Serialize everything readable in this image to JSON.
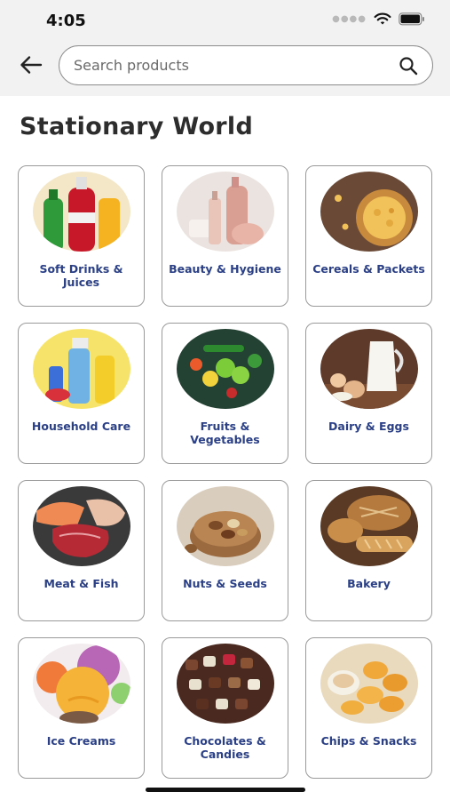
{
  "status_bar": {
    "time": "4:05",
    "icons": [
      "signal-dots-icon",
      "wifi-icon",
      "battery-icon"
    ]
  },
  "header": {
    "back_icon": "arrow-left-icon",
    "search": {
      "placeholder": "Search products",
      "value": "",
      "icon": "search-icon"
    }
  },
  "page": {
    "title": "Stationary World"
  },
  "categories": [
    {
      "label": "Soft Drinks & Juices",
      "icon": "soft-drinks-image"
    },
    {
      "label": "Beauty & Hygiene",
      "icon": "beauty-image"
    },
    {
      "label": "Cereals & Packets",
      "icon": "cereals-image"
    },
    {
      "label": "Household Care",
      "icon": "household-image"
    },
    {
      "label": "Fruits & Vegetables",
      "icon": "fruits-image"
    },
    {
      "label": "Dairy & Eggs",
      "icon": "dairy-image"
    },
    {
      "label": "Meat & Fish",
      "icon": "meat-image"
    },
    {
      "label": "Nuts & Seeds",
      "icon": "nuts-image"
    },
    {
      "label": "Bakery",
      "icon": "bakery-image"
    },
    {
      "label": "Ice Creams",
      "icon": "ice-cream-image"
    },
    {
      "label": "Chocolates & Candies",
      "icon": "chocolates-image"
    },
    {
      "label": "Chips & Snacks",
      "icon": "chips-image"
    }
  ],
  "colors": {
    "label_text": "#2a3f86",
    "title_text": "#2d2d2d",
    "header_bg": "#f2f2f2"
  }
}
